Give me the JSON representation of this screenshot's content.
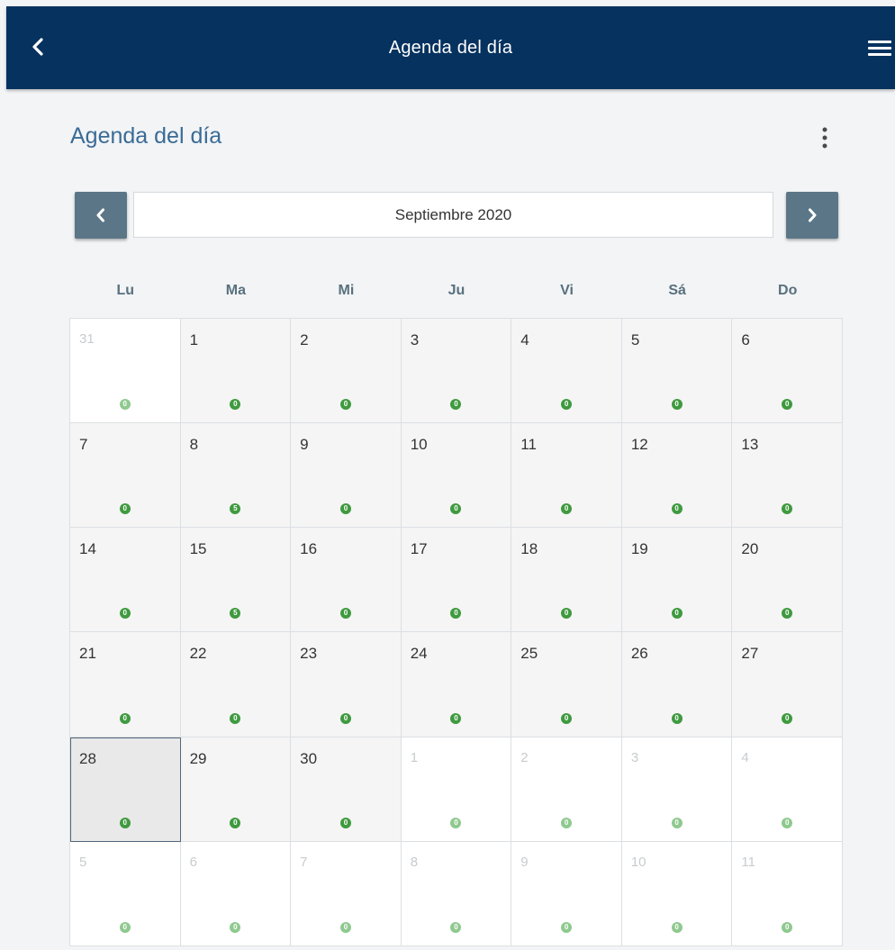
{
  "header": {
    "title": "Agenda del día",
    "back_icon": "chevron-left-icon",
    "menu_icon": "hamburger-menu-icon"
  },
  "section": {
    "title": "Agenda del día",
    "more_icon": "more-vertical-icon"
  },
  "navigator": {
    "month_label": "Septiembre 2020",
    "prev_icon": "chevron-left-icon",
    "next_icon": "chevron-right-icon"
  },
  "weekdays": [
    "Lu",
    "Ma",
    "Mi",
    "Ju",
    "Vi",
    "Sá",
    "Do"
  ],
  "weeks": [
    [
      {
        "day": "31",
        "outside": true,
        "badge": "0"
      },
      {
        "day": "1",
        "outside": false,
        "badge": "0"
      },
      {
        "day": "2",
        "outside": false,
        "badge": "0"
      },
      {
        "day": "3",
        "outside": false,
        "badge": "0"
      },
      {
        "day": "4",
        "outside": false,
        "badge": "0"
      },
      {
        "day": "5",
        "outside": false,
        "badge": "0"
      },
      {
        "day": "6",
        "outside": false,
        "badge": "0"
      }
    ],
    [
      {
        "day": "7",
        "outside": false,
        "badge": "0"
      },
      {
        "day": "8",
        "outside": false,
        "badge": "5"
      },
      {
        "day": "9",
        "outside": false,
        "badge": "0"
      },
      {
        "day": "10",
        "outside": false,
        "badge": "0"
      },
      {
        "day": "11",
        "outside": false,
        "badge": "0"
      },
      {
        "day": "12",
        "outside": false,
        "badge": "0"
      },
      {
        "day": "13",
        "outside": false,
        "badge": "0"
      }
    ],
    [
      {
        "day": "14",
        "outside": false,
        "badge": "0"
      },
      {
        "day": "15",
        "outside": false,
        "badge": "5"
      },
      {
        "day": "16",
        "outside": false,
        "badge": "0"
      },
      {
        "day": "17",
        "outside": false,
        "badge": "0"
      },
      {
        "day": "18",
        "outside": false,
        "badge": "0"
      },
      {
        "day": "19",
        "outside": false,
        "badge": "0"
      },
      {
        "day": "20",
        "outside": false,
        "badge": "0"
      }
    ],
    [
      {
        "day": "21",
        "outside": false,
        "badge": "0"
      },
      {
        "day": "22",
        "outside": false,
        "badge": "0"
      },
      {
        "day": "23",
        "outside": false,
        "badge": "0"
      },
      {
        "day": "24",
        "outside": false,
        "badge": "0"
      },
      {
        "day": "25",
        "outside": false,
        "badge": "0"
      },
      {
        "day": "26",
        "outside": false,
        "badge": "0"
      },
      {
        "day": "27",
        "outside": false,
        "badge": "0"
      }
    ],
    [
      {
        "day": "28",
        "outside": false,
        "badge": "0",
        "selected": true
      },
      {
        "day": "29",
        "outside": false,
        "badge": "0"
      },
      {
        "day": "30",
        "outside": false,
        "badge": "0"
      },
      {
        "day": "1",
        "outside": true,
        "badge": "0"
      },
      {
        "day": "2",
        "outside": true,
        "badge": "0"
      },
      {
        "day": "3",
        "outside": true,
        "badge": "0"
      },
      {
        "day": "4",
        "outside": true,
        "badge": "0"
      }
    ],
    [
      {
        "day": "5",
        "outside": true,
        "badge": "0"
      },
      {
        "day": "6",
        "outside": true,
        "badge": "0"
      },
      {
        "day": "7",
        "outside": true,
        "badge": "0"
      },
      {
        "day": "8",
        "outside": true,
        "badge": "0"
      },
      {
        "day": "9",
        "outside": true,
        "badge": "0"
      },
      {
        "day": "10",
        "outside": true,
        "badge": "0"
      },
      {
        "day": "11",
        "outside": true,
        "badge": "0"
      }
    ]
  ],
  "colors": {
    "appbar": "#06325f",
    "section_title": "#3b6b95",
    "nav_button": "#5b7787",
    "badge": "#3f9a3f",
    "badge_outside": "#8fc98f",
    "selected_border": "#53687a"
  }
}
